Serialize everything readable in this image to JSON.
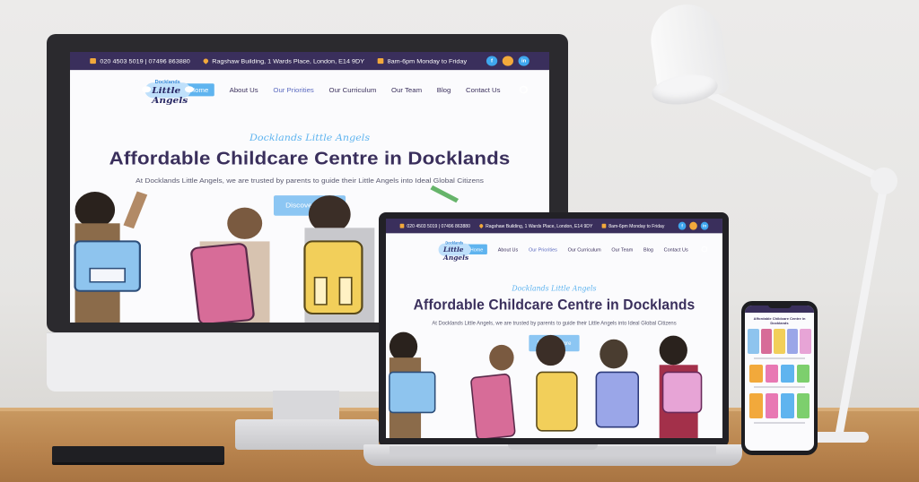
{
  "site": {
    "topbar": {
      "phone": "020 4503 5019 | 07496 863880",
      "address": "Ragshaw Building, 1 Wards Place, London, E14 9DY",
      "hours": "8am-6pm Monday to Friday"
    },
    "social": [
      "f",
      "in"
    ],
    "logo": {
      "top": "Docklands",
      "name": "Little Angels"
    },
    "nav": [
      "Home",
      "About Us",
      "Our Priorities",
      "Our Curriculum",
      "Our Team",
      "Blog",
      "Contact Us"
    ],
    "hero": {
      "eyebrow": "Docklands Little Angels",
      "headline": "Affordable Childcare Centre in Docklands",
      "sub": "At Docklands Little Angels, we are trusted by parents to guide their Little Angels into Ideal Global Citizens",
      "cta": "Discover More"
    }
  },
  "phone_site": {
    "headline": "Affordable Childcare Centre in Docklands"
  },
  "colors": {
    "topbar": "#3a2f5c",
    "accent": "#5fb4ef",
    "cta": "#8cc6f3",
    "headline": "#3a2f5c"
  }
}
